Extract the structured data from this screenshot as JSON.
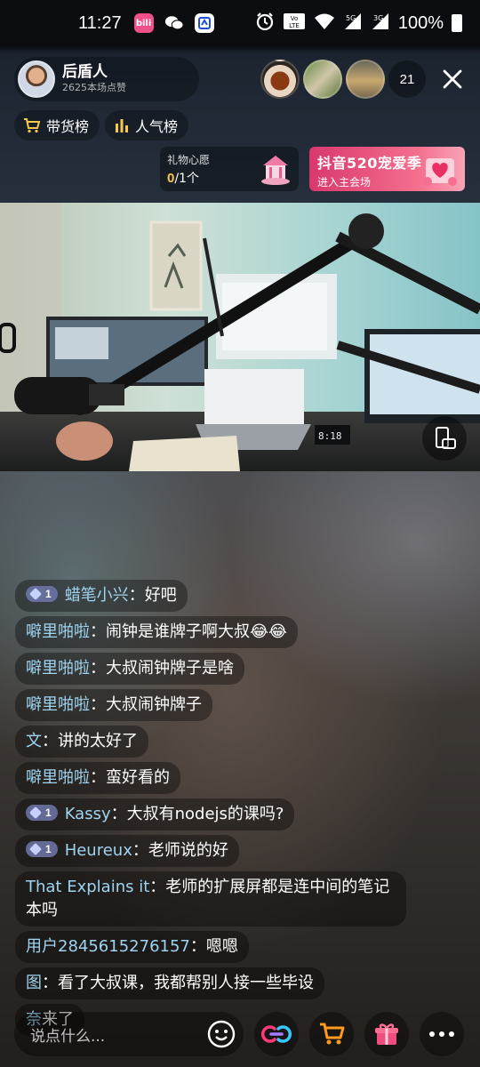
{
  "status_bar": {
    "time": "11:27",
    "battery": "100%",
    "network_a": "5G",
    "network_b": "3G",
    "volte": "VoLTE"
  },
  "host": {
    "name": "后盾人",
    "likes": "2625本场点赞"
  },
  "viewers": {
    "count": "21"
  },
  "pills": {
    "sales_rank": "带货榜",
    "popularity_rank": "人气榜"
  },
  "gift_wish": {
    "title": "礼物心愿",
    "current": "0",
    "total": "/1个"
  },
  "promo": {
    "title": "抖音520宠爱季",
    "subtitle": "进入主会场"
  },
  "chat": {
    "messages": [
      {
        "badge": "1",
        "user": "蜡笔小兴",
        "text": "好吧"
      },
      {
        "badge": "",
        "user": "噼里啪啦",
        "text": "闹钟是谁牌子啊大叔😂😂"
      },
      {
        "badge": "",
        "user": "噼里啪啦",
        "text": "大叔闹钟牌子是啥"
      },
      {
        "badge": "",
        "user": "噼里啪啦",
        "text": "大叔闹钟牌子"
      },
      {
        "badge": "",
        "user": "文",
        "text": "讲的太好了"
      },
      {
        "badge": "",
        "user": "噼里啪啦",
        "text": "蛮好看的"
      },
      {
        "badge": "1",
        "user": "Kassy",
        "text": "大叔有nodejs的课吗?"
      },
      {
        "badge": "1",
        "user": "Heureux",
        "text": "老师说的好"
      },
      {
        "badge": "",
        "user": "That Explains it",
        "text": "老师的扩展屏都是连中间的笔记本吗"
      },
      {
        "badge": "",
        "user": "用户2845615276157",
        "text": "嗯嗯"
      },
      {
        "badge": "",
        "user": "图",
        "text": "看了大叔课，我都帮别人接一些毕设"
      }
    ],
    "join": {
      "user": "奈",
      "text": "来了"
    },
    "separator": "："
  },
  "input": {
    "placeholder": "说点什么..."
  },
  "colors": {
    "username": "#9fd4f0",
    "accent_pink": "#f04e7e",
    "wish_count": "#f6c94a",
    "cart_orange": "#ff9a1f"
  }
}
